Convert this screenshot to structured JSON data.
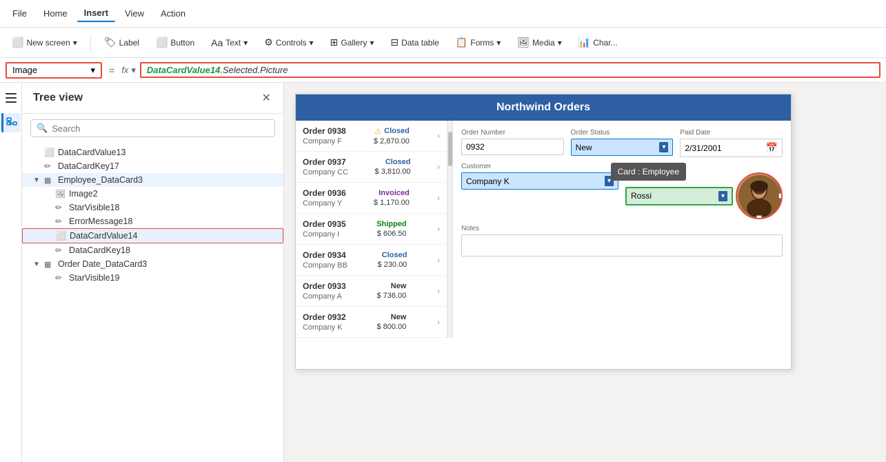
{
  "menu": {
    "items": [
      "File",
      "Home",
      "Insert",
      "View",
      "Action"
    ],
    "active": "Insert"
  },
  "toolbar": {
    "new_screen_label": "New screen",
    "label_label": "Label",
    "button_label": "Button",
    "text_label": "Text",
    "controls_label": "Controls",
    "gallery_label": "Gallery",
    "data_table_label": "Data table",
    "forms_label": "Forms",
    "media_label": "Media",
    "chart_label": "Char..."
  },
  "formula_bar": {
    "selector_value": "Image",
    "fx_label": "fx",
    "formula_part1": "DataCardValue14",
    "formula_part2": ".Selected.Picture"
  },
  "tree_view": {
    "title": "Tree view",
    "search_placeholder": "Search",
    "items": [
      {
        "id": "datacardvalue13",
        "label": "DataCardValue13",
        "indent": 2,
        "icon": "⬜"
      },
      {
        "id": "datacardkey17",
        "label": "DataCardKey17",
        "indent": 2,
        "icon": "✏️"
      },
      {
        "id": "employee_datacard3",
        "label": "Employee_DataCard3",
        "indent": 1,
        "icon": "⊞",
        "expanded": true
      },
      {
        "id": "image2",
        "label": "Image2",
        "indent": 3,
        "icon": "🖼"
      },
      {
        "id": "starvisible18",
        "label": "StarVisible18",
        "indent": 3,
        "icon": "✏️"
      },
      {
        "id": "errormessage18",
        "label": "ErrorMessage18",
        "indent": 3,
        "icon": "✏️"
      },
      {
        "id": "datacardvalue14",
        "label": "DataCardValue14",
        "indent": 3,
        "icon": "⬜",
        "selected": true
      },
      {
        "id": "datacardkey18",
        "label": "DataCardKey18",
        "indent": 3,
        "icon": "✏️"
      },
      {
        "id": "order_date_datacard3",
        "label": "Order Date_DataCard3",
        "indent": 1,
        "icon": "⊞",
        "expanded": true
      },
      {
        "id": "starvisible19",
        "label": "StarVisible19",
        "indent": 3,
        "icon": "✏️"
      }
    ]
  },
  "app": {
    "title": "Northwind Orders",
    "orders": [
      {
        "num": "Order 0938",
        "company": "Company F",
        "status": "Closed",
        "amount": "$ 2,870.00",
        "status_type": "closed",
        "warning": true
      },
      {
        "num": "Order 0937",
        "company": "Company CC",
        "status": "Closed",
        "amount": "$ 3,810.00",
        "status_type": "closed",
        "warning": false
      },
      {
        "num": "Order 0936",
        "company": "Company Y",
        "status": "Invoiced",
        "amount": "$ 1,170.00",
        "status_type": "invoiced",
        "warning": false
      },
      {
        "num": "Order 0935",
        "company": "Company I",
        "status": "Shipped",
        "amount": "$ 606.50",
        "status_type": "shipped",
        "warning": false
      },
      {
        "num": "Order 0934",
        "company": "Company BB",
        "status": "Closed",
        "amount": "$ 230.00",
        "status_type": "closed",
        "warning": false
      },
      {
        "num": "Order 0933",
        "company": "Company A",
        "status": "New",
        "amount": "$ 736.00",
        "status_type": "new",
        "warning": false
      },
      {
        "num": "Order 0932",
        "company": "Company K",
        "status": "New",
        "amount": "$ 800.00",
        "status_type": "new",
        "warning": false
      }
    ],
    "detail": {
      "order_number_label": "Order Number",
      "order_number_value": "0932",
      "order_status_label": "Order Status",
      "order_status_value": "New",
      "paid_date_label": "Paid Date",
      "paid_date_value": "2/31/2001",
      "customer_label": "Customer",
      "customer_value": "Company K",
      "employee_label": "Employee",
      "employee_value": "Rossi",
      "notes_label": "Notes",
      "notes_value": "",
      "employee_tooltip": "Card : Employee"
    }
  }
}
